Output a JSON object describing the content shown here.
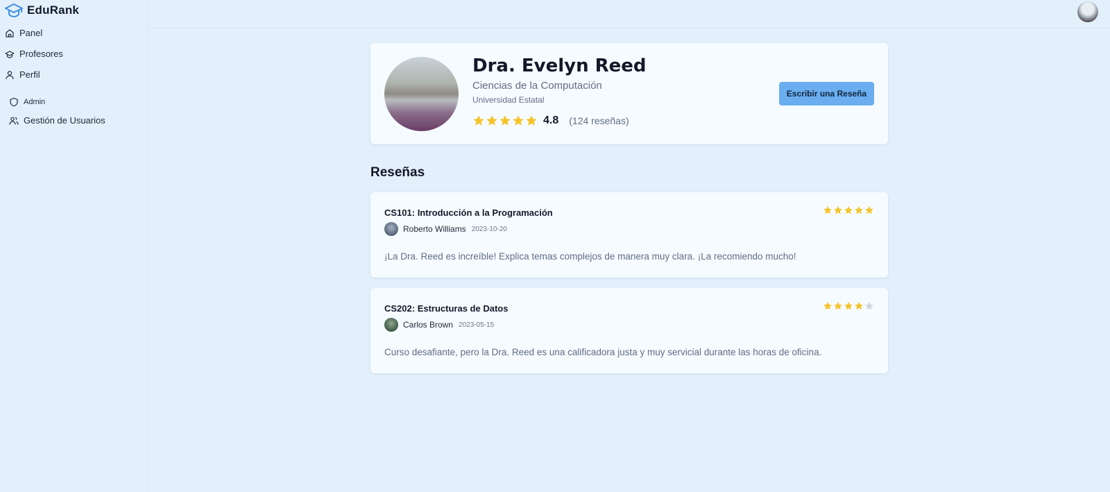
{
  "brand": {
    "name": "EduRank",
    "accent": "#3d8fe0"
  },
  "nav": {
    "panel": "Panel",
    "professors": "Profesores",
    "profile": "Perfil",
    "admin": "Admin",
    "user_management": "Gestión de Usuarios"
  },
  "professor": {
    "name": "Dra. Evelyn Reed",
    "department": "Ciencias de la Computación",
    "university": "Universidad Estatal",
    "rating": "4.8",
    "rating_stars": 5,
    "review_count": "(124 reseñas)",
    "write_review_label": "Escribir una Reseña"
  },
  "reviews_title": "Reseñas",
  "reviews": [
    {
      "course": "CS101: Introducción a la Programación",
      "reviewer": "Roberto Williams",
      "date": "2023-10-20",
      "stars": 5,
      "text": "¡La Dra. Reed es increíble! Explica temas complejos de manera muy clara. ¡La recomiendo mucho!"
    },
    {
      "course": "CS202: Estructuras de Datos",
      "reviewer": "Carlos Brown",
      "date": "2023-05-15",
      "stars": 4,
      "text": "Curso desafiante, pero la Dra. Reed es una calificadora justa y muy servicial durante las horas de oficina."
    }
  ],
  "colors": {
    "star_filled": "#f5c42c",
    "star_empty": "#cdd5df",
    "button": "#6aaef0"
  }
}
